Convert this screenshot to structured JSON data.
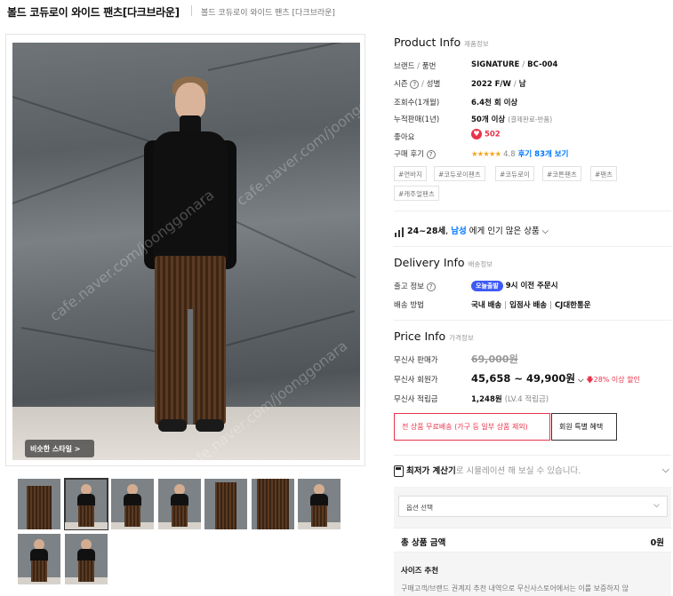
{
  "header": {
    "title": "볼드 코듀로이 와이드 팬츠[다크브라운]",
    "subtitle": "볼드 코듀로이 와이드 팬츠 [다크브라운]"
  },
  "gallery": {
    "similar_style_label": "비슷한 스타일 >",
    "watermark": "cafe.naver.com/joonggonara",
    "thumbnail_count": 9,
    "selected_thumbnail": 2
  },
  "product_info": {
    "title": "Product Info",
    "subtitle": "제품정보",
    "brand_label": "브랜드",
    "sep": "/",
    "product_no_label": "품번",
    "brand_value": "SIGNATURE",
    "product_no_value": "BC-004",
    "season_label": "시즌",
    "gender_label": "성별",
    "season_value": "2022 F/W",
    "gender_value": "남",
    "views_label": "조회수(1개월)",
    "views_value": "6.4천 회 이상",
    "sales_label": "누적판매(1년)",
    "sales_value": "50개 이상",
    "sales_note": "(결제완료-반품)",
    "likes_label": "좋아요",
    "likes_value": "502",
    "review_label": "구매 후기",
    "review_stars": "★★★★★",
    "review_score": "4.8",
    "review_link": "후기 83개 보기",
    "tags": [
      "#면바지",
      "#코듀로이팬츠",
      "#코듀로이",
      "#코튼팬츠",
      "#팬츠",
      "#캐주얼팬츠"
    ]
  },
  "popular": {
    "age": "24~28세",
    "sep": ",",
    "gender": "남성",
    "text": "에게 인기 많은 상품"
  },
  "delivery_info": {
    "title": "Delivery Info",
    "subtitle": "배송정보",
    "ship_label": "출고 정보",
    "early_badge": "오늘출발",
    "ship_value": "9시 이전 주문시",
    "method_label": "배송 방법",
    "method_values": [
      "국내 배송",
      "입점사 배송",
      "CJ대한통운"
    ]
  },
  "price_info": {
    "title": "Price Info",
    "subtitle": "가격정보",
    "store_price_label": "무신사 판매가",
    "store_price": "69,000원",
    "member_price_label": "무신사 회원가",
    "member_price": "45,658 ~ 49,900원",
    "discount": "28% 이상 할인",
    "points_label": "무신사 적립금",
    "points_value": "1,248원",
    "points_note": "(LV.4 적립금)",
    "free_shipping_btn": "전 상품 무료배송 (가구 등 일부 상품 제외)",
    "member_benefit_btn": "회원 특별 혜택"
  },
  "calculator": {
    "title": "최저가 계산기",
    "text": "로 시뮬레이션 해 보실 수 있습니다."
  },
  "order": {
    "option_placeholder": "옵션 선택",
    "total_label": "총 상품 금액",
    "total_value": "0원",
    "size_recommend_title": "사이즈 추천",
    "size_recommend_text": "구매고객/브랜드 권계지 추천 내역으로 무신사스토어에서는 이를 보증하지 않"
  },
  "colors": {
    "accent_red": "#e8334a",
    "link_blue": "#0078ff",
    "badge_blue": "#3d59f5",
    "star": "#f5a623"
  }
}
